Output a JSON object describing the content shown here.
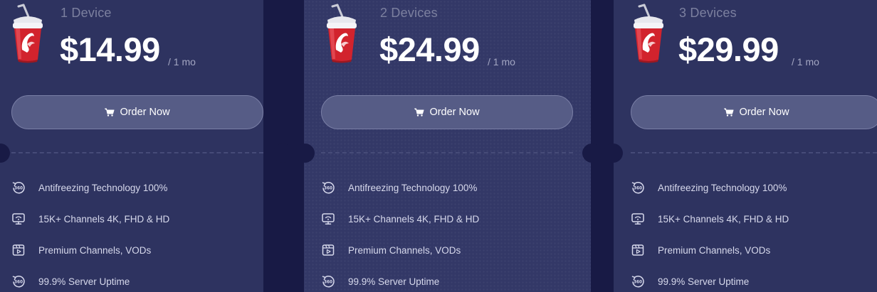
{
  "plans": [
    {
      "devices": "1 Device",
      "price": "$14.99",
      "period": "/ 1 mo",
      "button_label": "Order Now",
      "features": [
        {
          "icon": "360-rotate-icon",
          "label": "Antifreezing Technology 100%"
        },
        {
          "icon": "tv-signal-icon",
          "label": "15K+ Channels 4K, FHD & HD"
        },
        {
          "icon": "video-player-icon",
          "label": "Premium Channels, VODs"
        },
        {
          "icon": "360-rotate-icon",
          "label": "99.9% Server Uptime"
        }
      ]
    },
    {
      "devices": "2 Devices",
      "price": "$24.99",
      "period": "/ 1 mo",
      "button_label": "Order Now",
      "features": [
        {
          "icon": "360-rotate-icon",
          "label": "Antifreezing Technology 100%"
        },
        {
          "icon": "tv-signal-icon",
          "label": "15K+ Channels 4K, FHD & HD"
        },
        {
          "icon": "video-player-icon",
          "label": "Premium Channels, VODs"
        },
        {
          "icon": "360-rotate-icon",
          "label": "99.9% Server Uptime"
        }
      ]
    },
    {
      "devices": "3 Devices",
      "price": "$29.99",
      "period": "/ 1 mo",
      "button_label": "Order Now",
      "features": [
        {
          "icon": "360-rotate-icon",
          "label": "Antifreezing Technology 100%"
        },
        {
          "icon": "tv-signal-icon",
          "label": "15K+ Channels 4K, FHD & HD"
        },
        {
          "icon": "video-player-icon",
          "label": "Premium Channels, VODs"
        },
        {
          "icon": "360-rotate-icon",
          "label": "99.9% Server Uptime"
        }
      ]
    }
  ],
  "colors": {
    "page_background": "#181a45",
    "card_background": "#2e3360",
    "button_background": "#565c86",
    "cup_red": "#d2232d",
    "text_muted": "#7c809f"
  }
}
